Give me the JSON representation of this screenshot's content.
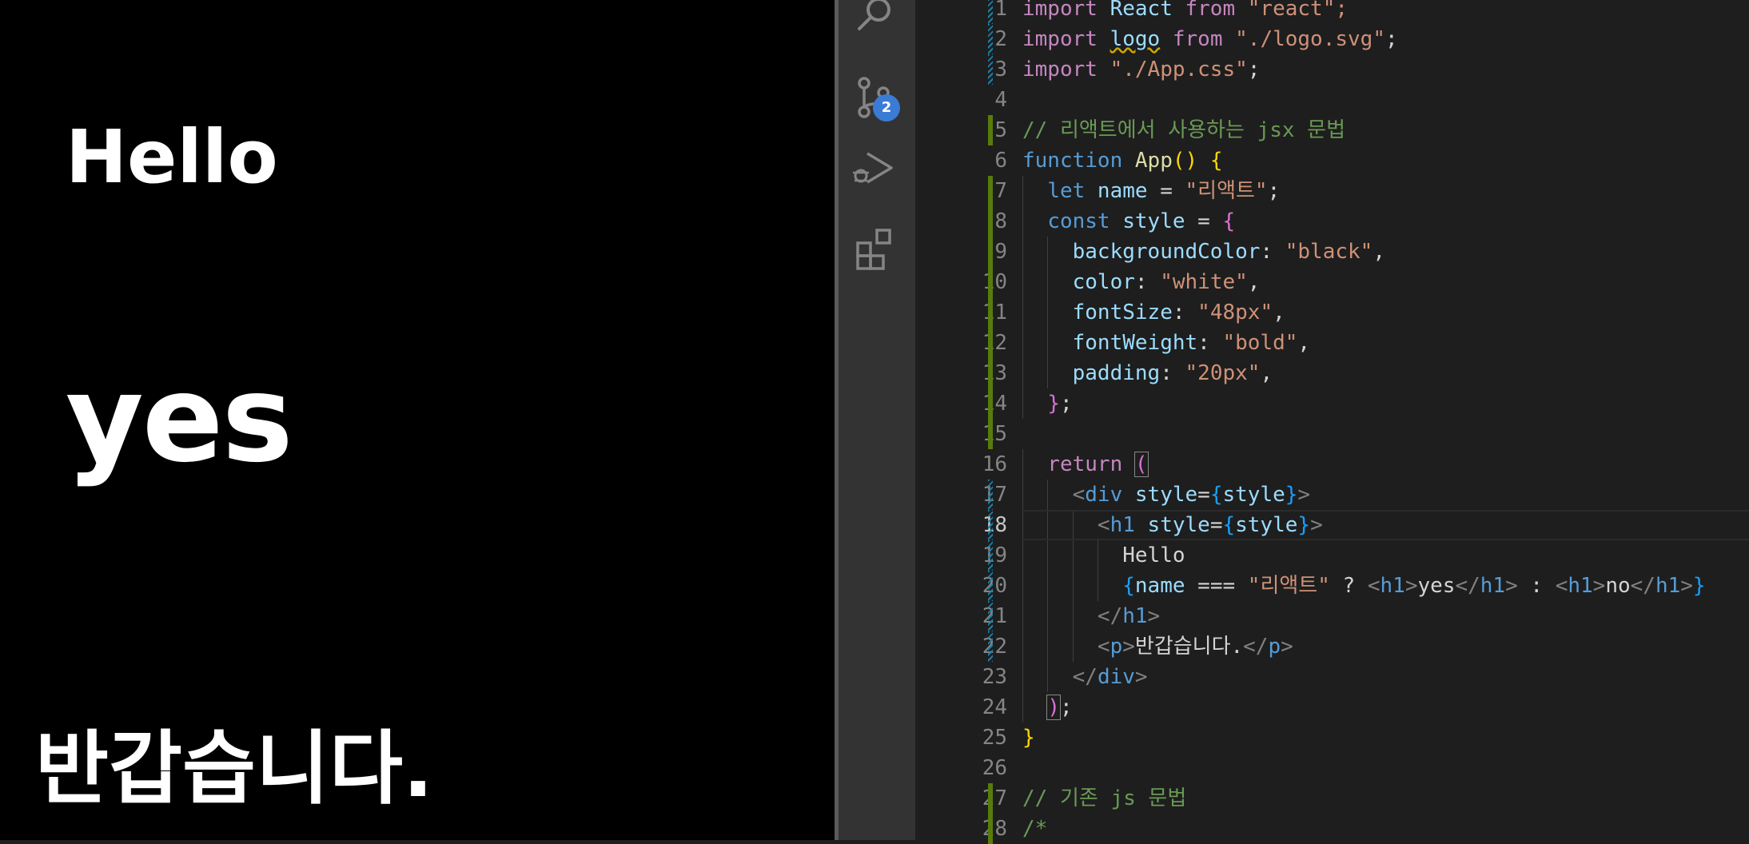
{
  "preview": {
    "heading_text": "Hello",
    "conditional_text": "yes",
    "paragraph_text": "반갑습니다."
  },
  "activity_bar": {
    "items": [
      {
        "icon": "search-icon"
      },
      {
        "icon": "source-control-icon",
        "badge": "2"
      },
      {
        "icon": "run-debug-icon"
      },
      {
        "icon": "extensions-icon"
      }
    ]
  },
  "editor": {
    "current_line": 18,
    "line_numbers": [
      "1",
      "2",
      "3",
      "4",
      "5",
      "6",
      "7",
      "8",
      "9",
      "10",
      "11",
      "12",
      "13",
      "14",
      "15",
      "16",
      "17",
      "18",
      "19",
      "20",
      "21",
      "22",
      "23",
      "24",
      "25",
      "26",
      "27",
      "28"
    ],
    "lines": [
      {
        "tokens": [
          {
            "t": "import",
            "c": "kw"
          },
          {
            "t": " React ",
            "c": "vr"
          },
          {
            "t": "from",
            "c": "kw"
          },
          {
            "t": " \"react\";",
            "c": "st"
          }
        ],
        "indent": 0,
        "mark": "modified"
      },
      {
        "tokens": [
          {
            "t": "import",
            "c": "kw"
          },
          {
            "t": " ",
            "c": ""
          },
          {
            "t": "logo",
            "c": "vr wavy"
          },
          {
            "t": " ",
            "c": ""
          },
          {
            "t": "from",
            "c": "kw"
          },
          {
            "t": " \"./logo.svg\"",
            "c": "st"
          },
          {
            "t": ";",
            "c": ""
          }
        ],
        "indent": 0,
        "mark": "modified"
      },
      {
        "tokens": [
          {
            "t": "import",
            "c": "kw"
          },
          {
            "t": " \"./App.css\"",
            "c": "st"
          },
          {
            "t": ";",
            "c": ""
          }
        ],
        "indent": 0,
        "mark": "modified"
      },
      {
        "tokens": [],
        "indent": 0,
        "mark": ""
      },
      {
        "tokens": [
          {
            "t": "// 리액트에서 사용하는 jsx 문법",
            "c": "cm"
          }
        ],
        "indent": 0,
        "mark": "added"
      },
      {
        "tokens": [
          {
            "t": "function",
            "c": "bl"
          },
          {
            "t": " ",
            "c": ""
          },
          {
            "t": "App",
            "c": "fn"
          },
          {
            "t": "()",
            "c": "br1"
          },
          {
            "t": " ",
            "c": ""
          },
          {
            "t": "{",
            "c": "br1"
          }
        ],
        "indent": 0,
        "mark": ""
      },
      {
        "tokens": [
          {
            "t": "let",
            "c": "bl"
          },
          {
            "t": " name ",
            "c": "vr"
          },
          {
            "t": "= ",
            "c": ""
          },
          {
            "t": "\"리액트\"",
            "c": "st"
          },
          {
            "t": ";",
            "c": ""
          }
        ],
        "indent": 1,
        "mark": "added"
      },
      {
        "tokens": [
          {
            "t": "const",
            "c": "bl"
          },
          {
            "t": " style ",
            "c": "vr"
          },
          {
            "t": "= ",
            "c": ""
          },
          {
            "t": "{",
            "c": "br2"
          }
        ],
        "indent": 1,
        "mark": "added"
      },
      {
        "tokens": [
          {
            "t": "backgroundColor",
            "c": "vr"
          },
          {
            "t": ": ",
            "c": ""
          },
          {
            "t": "\"black\"",
            "c": "st"
          },
          {
            "t": ",",
            "c": ""
          }
        ],
        "indent": 2,
        "mark": "added"
      },
      {
        "tokens": [
          {
            "t": "color",
            "c": "vr"
          },
          {
            "t": ": ",
            "c": ""
          },
          {
            "t": "\"white\"",
            "c": "st"
          },
          {
            "t": ",",
            "c": ""
          }
        ],
        "indent": 2,
        "mark": "added"
      },
      {
        "tokens": [
          {
            "t": "fontSize",
            "c": "vr"
          },
          {
            "t": ": ",
            "c": ""
          },
          {
            "t": "\"48px\"",
            "c": "st"
          },
          {
            "t": ",",
            "c": ""
          }
        ],
        "indent": 2,
        "mark": "added"
      },
      {
        "tokens": [
          {
            "t": "fontWeight",
            "c": "vr"
          },
          {
            "t": ": ",
            "c": ""
          },
          {
            "t": "\"bold\"",
            "c": "st"
          },
          {
            "t": ",",
            "c": ""
          }
        ],
        "indent": 2,
        "mark": "added"
      },
      {
        "tokens": [
          {
            "t": "padding",
            "c": "vr"
          },
          {
            "t": ": ",
            "c": ""
          },
          {
            "t": "\"20px\"",
            "c": "st"
          },
          {
            "t": ",",
            "c": ""
          }
        ],
        "indent": 2,
        "mark": "added"
      },
      {
        "tokens": [
          {
            "t": "}",
            "c": "br2"
          },
          {
            "t": ";",
            "c": ""
          }
        ],
        "indent": 1,
        "mark": "added"
      },
      {
        "tokens": [],
        "indent": 0,
        "mark": "added"
      },
      {
        "tokens": [
          {
            "t": "return",
            "c": "kw"
          },
          {
            "t": " ",
            "c": ""
          },
          {
            "t": "(",
            "c": "br2 bracket-hl"
          }
        ],
        "indent": 1,
        "mark": ""
      },
      {
        "tokens": [
          {
            "t": "<",
            "c": "tgb"
          },
          {
            "t": "div",
            "c": "tg"
          },
          {
            "t": " style",
            "c": "vr"
          },
          {
            "t": "=",
            "c": ""
          },
          {
            "t": "{",
            "c": "br3"
          },
          {
            "t": "style",
            "c": "vr"
          },
          {
            "t": "}",
            "c": "br3"
          },
          {
            "t": ">",
            "c": "tgb"
          }
        ],
        "indent": 2,
        "mark": "modified"
      },
      {
        "tokens": [
          {
            "t": "<",
            "c": "tgb"
          },
          {
            "t": "h1",
            "c": "tg"
          },
          {
            "t": " style",
            "c": "vr"
          },
          {
            "t": "=",
            "c": ""
          },
          {
            "t": "{",
            "c": "br3"
          },
          {
            "t": "style",
            "c": "vr"
          },
          {
            "t": "}",
            "c": "br3"
          },
          {
            "t": ">",
            "c": "tgb"
          }
        ],
        "indent": 3,
        "mark": "modified"
      },
      {
        "tokens": [
          {
            "t": "Hello",
            "c": ""
          }
        ],
        "indent": 4,
        "mark": "modified"
      },
      {
        "tokens": [
          {
            "t": "{",
            "c": "br3"
          },
          {
            "t": "name ",
            "c": "vr"
          },
          {
            "t": "=== ",
            "c": ""
          },
          {
            "t": "\"리액트\"",
            "c": "st"
          },
          {
            "t": " ? ",
            "c": ""
          },
          {
            "t": "<",
            "c": "tgb"
          },
          {
            "t": "h1",
            "c": "tg"
          },
          {
            "t": ">",
            "c": "tgb"
          },
          {
            "t": "yes",
            "c": ""
          },
          {
            "t": "</",
            "c": "tgb"
          },
          {
            "t": "h1",
            "c": "tg"
          },
          {
            "t": ">",
            "c": "tgb"
          },
          {
            "t": " : ",
            "c": ""
          },
          {
            "t": "<",
            "c": "tgb"
          },
          {
            "t": "h1",
            "c": "tg"
          },
          {
            "t": ">",
            "c": "tgb"
          },
          {
            "t": "no",
            "c": ""
          },
          {
            "t": "</",
            "c": "tgb"
          },
          {
            "t": "h1",
            "c": "tg"
          },
          {
            "t": ">",
            "c": "tgb"
          },
          {
            "t": "}",
            "c": "br3"
          }
        ],
        "indent": 4,
        "mark": "modified"
      },
      {
        "tokens": [
          {
            "t": "</",
            "c": "tgb"
          },
          {
            "t": "h1",
            "c": "tg"
          },
          {
            "t": ">",
            "c": "tgb"
          }
        ],
        "indent": 3,
        "mark": "modified"
      },
      {
        "tokens": [
          {
            "t": "<",
            "c": "tgb"
          },
          {
            "t": "p",
            "c": "tg"
          },
          {
            "t": ">",
            "c": "tgb"
          },
          {
            "t": "반갑습니다.",
            "c": ""
          },
          {
            "t": "</",
            "c": "tgb"
          },
          {
            "t": "p",
            "c": "tg"
          },
          {
            "t": ">",
            "c": "tgb"
          }
        ],
        "indent": 3,
        "mark": "modified"
      },
      {
        "tokens": [
          {
            "t": "</",
            "c": "tgb"
          },
          {
            "t": "div",
            "c": "tg"
          },
          {
            "t": ">",
            "c": "tgb"
          }
        ],
        "indent": 2,
        "mark": ""
      },
      {
        "tokens": [
          {
            "t": ")",
            "c": "br2 bracket-hl"
          },
          {
            "t": ";",
            "c": ""
          }
        ],
        "indent": 1,
        "mark": ""
      },
      {
        "tokens": [
          {
            "t": "}",
            "c": "br1"
          }
        ],
        "indent": 0,
        "mark": ""
      },
      {
        "tokens": [],
        "indent": 0,
        "mark": ""
      },
      {
        "tokens": [
          {
            "t": "// 기존 js 문법",
            "c": "cm"
          }
        ],
        "indent": 0,
        "mark": "added"
      },
      {
        "tokens": [
          {
            "t": "/*",
            "c": "cm"
          }
        ],
        "indent": 0,
        "mark": "added"
      }
    ]
  }
}
